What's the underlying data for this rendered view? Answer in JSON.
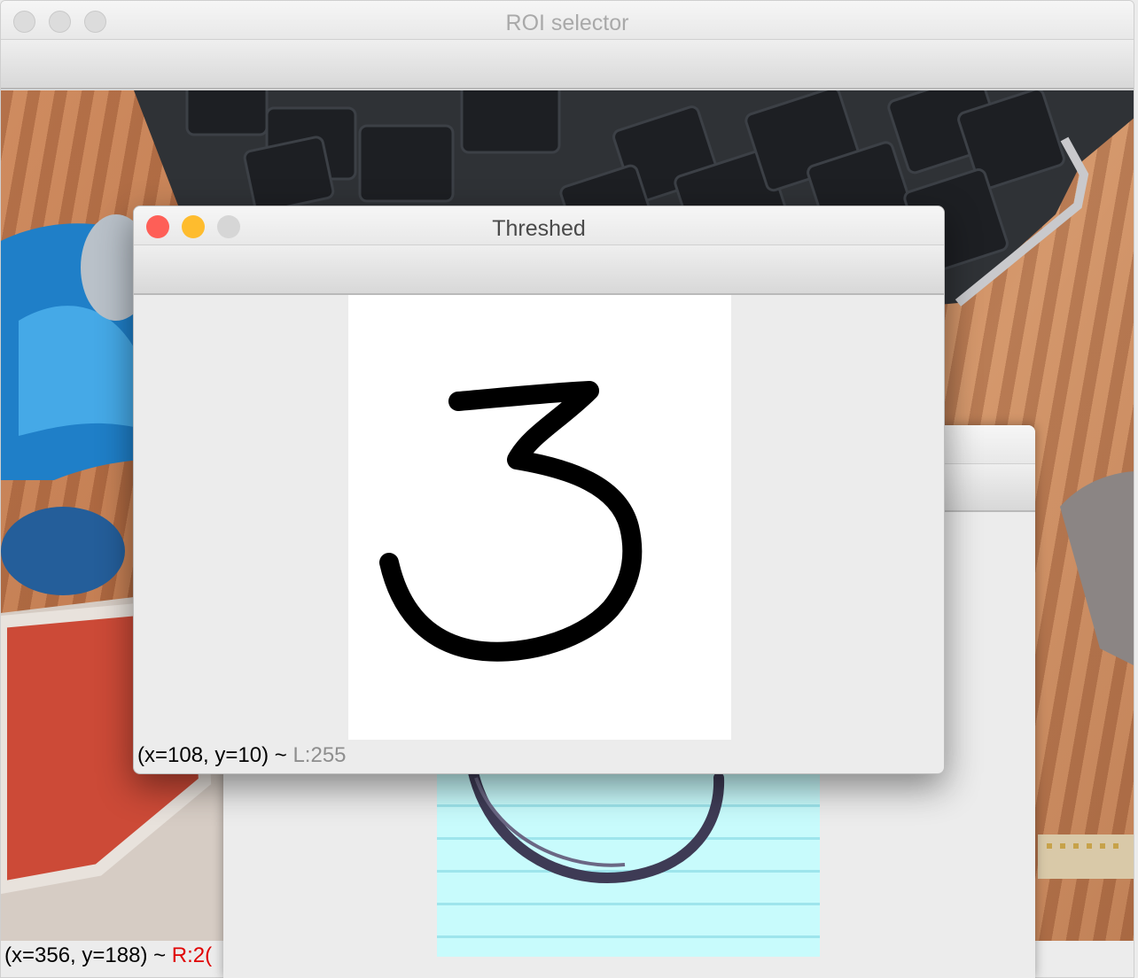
{
  "roi_window": {
    "title": "ROI selector",
    "status_prefix": "(x=356, y=188) ~ ",
    "status_value": "R:2("
  },
  "threshed_window": {
    "title": "Threshed",
    "status_prefix": "(x=108, y=10) ~ ",
    "status_value": "L:255"
  },
  "colors": {
    "close": "#fe5f57",
    "minimize": "#febc2e",
    "zoom_disabled": "#d6d6d6"
  }
}
